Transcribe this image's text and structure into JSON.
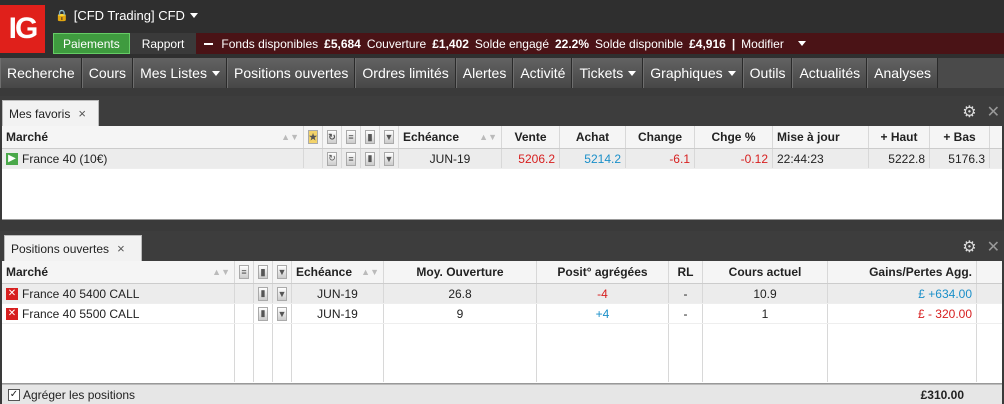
{
  "logo": {
    "text": "IG"
  },
  "account": {
    "name": "[CFD Trading] CFD"
  },
  "acctbar": {
    "paiements": "Paiements",
    "rapport": "Rapport",
    "fonds_label": "Fonds disponibles",
    "fonds_value": "£5,684",
    "couverture_label": "Couverture",
    "couverture_value": "£1,402",
    "solde_engage_label": "Solde engagé",
    "solde_engage_value": "22.2%",
    "solde_dispo_label": "Solde disponible",
    "solde_dispo_value": "£4,916",
    "sep": "|",
    "modifier": "Modifier"
  },
  "nav": [
    {
      "label": "Recherche",
      "menu": false
    },
    {
      "label": "Cours",
      "menu": false
    },
    {
      "label": "Mes Listes",
      "menu": true
    },
    {
      "label": "Positions ouvertes",
      "menu": false
    },
    {
      "label": "Ordres limités",
      "menu": false
    },
    {
      "label": "Alertes",
      "menu": false
    },
    {
      "label": "Activité",
      "menu": false
    },
    {
      "label": "Tickets",
      "menu": true
    },
    {
      "label": "Graphiques",
      "menu": true
    },
    {
      "label": "Outils",
      "menu": false
    },
    {
      "label": "Actualités",
      "menu": false
    },
    {
      "label": "Analyses",
      "menu": false
    }
  ],
  "favoris": {
    "tab_label": "Mes favoris",
    "close": "×",
    "headers": {
      "marche": "Marché",
      "echeance": "Echéance",
      "vente": "Vente",
      "achat": "Achat",
      "change": "Change",
      "chge_pct": "Chge %",
      "mise_a_jour": "Mise à jour",
      "haut": "+ Haut",
      "bas": "+ Bas"
    },
    "row": {
      "marche": "France 40 (10€)",
      "echeance": "JUN-19",
      "vente": "5206.2",
      "achat": "5214.2",
      "change": "-6.1",
      "chge_pct": "-0.12",
      "mise_a_jour": "22:44:23",
      "haut": "5222.8",
      "bas": "5176.3"
    }
  },
  "positions": {
    "tab_label": "Positions ouvertes",
    "close": "×",
    "headers": {
      "marche": "Marché",
      "echeance": "Echéance",
      "moy_ouverture": "Moy. Ouverture",
      "posit": "Posit° agrégées",
      "rl": "RL",
      "cours": "Cours actuel",
      "gains": "Gains/Pertes Agg."
    },
    "rows": [
      {
        "marche": "France 40 5400 CALL",
        "echeance": "JUN-19",
        "moy": "26.8",
        "posit": "-4",
        "rl": "-",
        "cours": "10.9",
        "gains": "£ +634.00"
      },
      {
        "marche": "France 40 5500 CALL",
        "echeance": "JUN-19",
        "moy": "9",
        "posit": "+4",
        "rl": "-",
        "cours": "1",
        "gains": "£ - 320.00"
      }
    ],
    "footer_label": "Agréger les positions",
    "total": "£310.00"
  },
  "colors": {
    "brand": "#e0201b",
    "positive": "#1a8fc9",
    "negative": "#d71f1f",
    "pay": "#3f9b3f"
  }
}
